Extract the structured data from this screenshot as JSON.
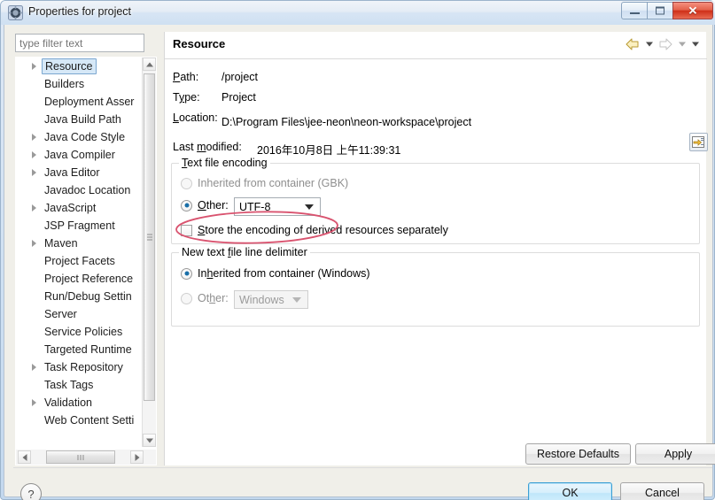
{
  "window": {
    "title": "Properties for project",
    "icon": "eclipse-properties-icon",
    "caption_buttons": {
      "minimize": "minimize-button",
      "maximize": "maximize-button",
      "close_label": "✕"
    }
  },
  "filter": {
    "placeholder": "type filter text",
    "value": ""
  },
  "tree": {
    "items": [
      {
        "label": "Resource",
        "expandable": true,
        "selected": true
      },
      {
        "label": "Builders",
        "expandable": false,
        "selected": false
      },
      {
        "label": "Deployment Asser",
        "expandable": false,
        "selected": false
      },
      {
        "label": "Java Build Path",
        "expandable": false,
        "selected": false
      },
      {
        "label": "Java Code Style",
        "expandable": true,
        "selected": false
      },
      {
        "label": "Java Compiler",
        "expandable": true,
        "selected": false
      },
      {
        "label": "Java Editor",
        "expandable": true,
        "selected": false
      },
      {
        "label": "Javadoc Location",
        "expandable": false,
        "selected": false
      },
      {
        "label": "JavaScript",
        "expandable": true,
        "selected": false
      },
      {
        "label": "JSP Fragment",
        "expandable": false,
        "selected": false
      },
      {
        "label": "Maven",
        "expandable": true,
        "selected": false
      },
      {
        "label": "Project Facets",
        "expandable": false,
        "selected": false
      },
      {
        "label": "Project Reference",
        "expandable": false,
        "selected": false
      },
      {
        "label": "Run/Debug Settin",
        "expandable": false,
        "selected": false
      },
      {
        "label": "Server",
        "expandable": false,
        "selected": false
      },
      {
        "label": "Service Policies",
        "expandable": false,
        "selected": false
      },
      {
        "label": "Targeted Runtime",
        "expandable": false,
        "selected": false
      },
      {
        "label": "Task Repository",
        "expandable": true,
        "selected": false
      },
      {
        "label": "Task Tags",
        "expandable": false,
        "selected": false
      },
      {
        "label": "Validation",
        "expandable": true,
        "selected": false
      },
      {
        "label": "Web Content Setti",
        "expandable": false,
        "selected": false
      }
    ]
  },
  "content": {
    "title": "Resource",
    "nav": {
      "back_icon": "back-arrow-icon",
      "back_menu_icon": "chevron-down-icon",
      "forward_icon": "forward-arrow-icon",
      "forward_menu_icon": "chevron-down-icon",
      "view_menu_icon": "chevron-down-icon"
    },
    "fields": [
      {
        "label": "Path:",
        "value": "/project"
      },
      {
        "label": "Type:",
        "value": "Project"
      },
      {
        "label": "Location:",
        "value": "D:\\Program Files\\jee-neon\\neon-workspace\\project"
      }
    ],
    "last_modified": {
      "label": "Last modified:",
      "value": "2016年10月8日 上午11:39:31"
    },
    "location_button_icon": "open-folder-arrow-icon",
    "encoding_group": {
      "title": "Text file encoding",
      "inherited_label": "Inherited from container (GBK)",
      "inherited_checked": false,
      "other_label": "Other:",
      "other_checked": true,
      "other_value": "UTF-8",
      "store_derived_label": "Store the encoding of derived resources separately",
      "store_derived_checked": false
    },
    "delimiter_group": {
      "title": "New text file line delimiter",
      "inherited_label": "Inherited from container (Windows)",
      "inherited_checked": true,
      "other_label": "Other:",
      "other_checked": false,
      "other_value": "Windows"
    },
    "annotation": {
      "shape": "red-ellipse",
      "color": "#d9536f",
      "target": "other-encoding-utf8"
    }
  },
  "buttons": {
    "restore_defaults": "Restore Defaults",
    "apply": "Apply",
    "ok": "OK",
    "cancel": "Cancel",
    "help_glyph": "?"
  },
  "colors": {
    "accent": "#3c9fd4",
    "annotation": "#d9536f",
    "selection": "#d6e8f7",
    "dialog_bg": "#f0efe9",
    "content_bg": "#ffffff"
  }
}
